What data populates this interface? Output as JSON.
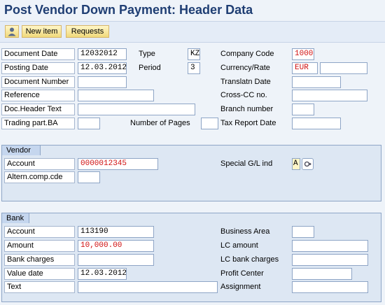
{
  "title": "Post Vendor Down Payment: Header Data",
  "toolbar": {
    "icon": "person-icon",
    "new_item": "New item",
    "requests": "Requests"
  },
  "header": {
    "document_date": {
      "label": "Document Date",
      "value": "12032012"
    },
    "type": {
      "label": "Type",
      "value": "KZ"
    },
    "company_code": {
      "label": "Company Code",
      "value": "1000"
    },
    "posting_date": {
      "label": "Posting Date",
      "value": "12.03.2012"
    },
    "period": {
      "label": "Period",
      "value": "3"
    },
    "currency_rate": {
      "label": "Currency/Rate",
      "value": "EUR",
      "rate": ""
    },
    "document_number": {
      "label": "Document Number",
      "value": ""
    },
    "translation_date": {
      "label": "Translatn Date",
      "value": ""
    },
    "reference": {
      "label": "Reference",
      "value": ""
    },
    "cross_cc_no": {
      "label": "Cross-CC no.",
      "value": ""
    },
    "doc_header_text": {
      "label": "Doc.Header Text",
      "value": ""
    },
    "branch_number": {
      "label": "Branch number",
      "value": ""
    },
    "trading_part_ba": {
      "label": "Trading part.BA",
      "value": ""
    },
    "number_of_pages": {
      "label": "Number of Pages",
      "value": ""
    },
    "tax_report_date": {
      "label": "Tax Report Date",
      "value": ""
    }
  },
  "vendor": {
    "tab_label": "Vendor",
    "account": {
      "label": "Account",
      "value": "0000012345"
    },
    "altern_comp_cde": {
      "label": "Altern.comp.cde",
      "value": ""
    },
    "special_gl_ind": {
      "label": "Special G/L ind",
      "value": "A"
    }
  },
  "bank": {
    "tab_label": "Bank",
    "account": {
      "label": "Account",
      "value": "113190"
    },
    "business_area": {
      "label": "Business Area",
      "value": ""
    },
    "amount": {
      "label": "Amount",
      "value": "10,000.00"
    },
    "lc_amount": {
      "label": "LC amount",
      "value": ""
    },
    "bank_charges": {
      "label": "Bank charges",
      "value": ""
    },
    "lc_bank_charges": {
      "label": "LC bank charges",
      "value": ""
    },
    "value_date": {
      "label": "Value date",
      "value": "12.03.2012"
    },
    "profit_center": {
      "label": "Profit Center",
      "value": ""
    },
    "text": {
      "label": "Text",
      "value": ""
    },
    "assignment": {
      "label": "Assignment",
      "value": ""
    }
  },
  "colors": {
    "title": "#1f3e73",
    "background": "#eef3f9",
    "group_background": "#dde7f3",
    "required_text": "#d01010",
    "button": "#f0d97a"
  }
}
